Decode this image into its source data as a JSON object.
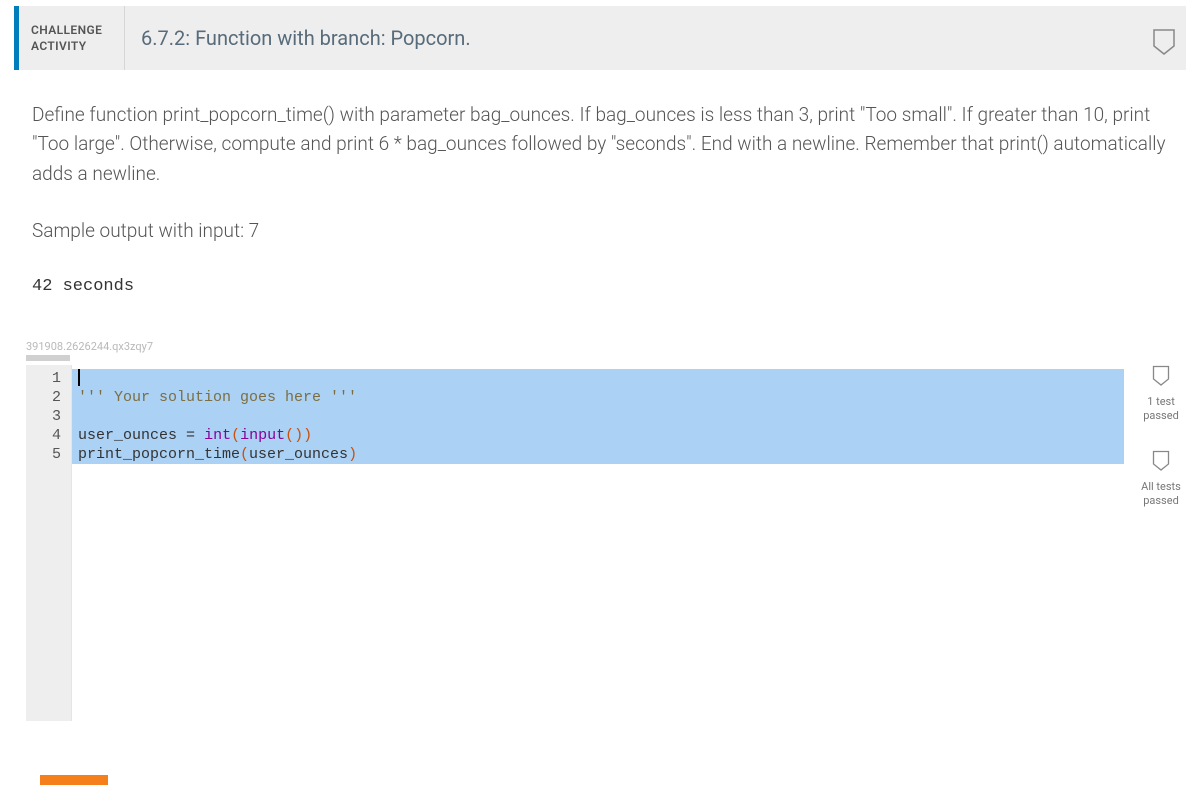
{
  "header": {
    "category_line1": "CHALLENGE",
    "category_line2": "ACTIVITY",
    "title": "6.7.2: Function with branch: Popcorn."
  },
  "problem": {
    "description": "Define function print_popcorn_time() with parameter bag_ounces. If bag_ounces is less than 3, print \"Too small\". If greater than 10, print \"Too large\". Otherwise, compute and print 6 * bag_ounces followed by \"seconds\". End with a newline. Remember that print() automatically adds a newline.",
    "sample_label": "Sample output with input: 7",
    "sample_output": "42 seconds"
  },
  "editor": {
    "id_string": "391908.2626244.qx3zqy7",
    "line_numbers": [
      "1",
      "2",
      "3",
      "4",
      "5"
    ],
    "lines": {
      "l1": "",
      "l2_comment": "''' Your solution goes here '''",
      "l3": "",
      "l4_plain_a": "user_ounces ",
      "l4_op": "=",
      "l4_plain_b": " ",
      "l4_fn1": "int",
      "l4_paren1": "(",
      "l4_fn2": "input",
      "l4_paren2": "(",
      "l4_paren3": ")",
      "l4_paren4": ")",
      "l5_call": "print_popcorn_time",
      "l5_paren1": "(",
      "l5_arg": "user_ounces",
      "l5_paren2": ")"
    }
  },
  "badges": {
    "b1": "1 test passed",
    "b2": "All tests passed"
  },
  "colors": {
    "accent": "#007dba",
    "selection": "#abd1f4",
    "orange": "#f47f1b"
  }
}
